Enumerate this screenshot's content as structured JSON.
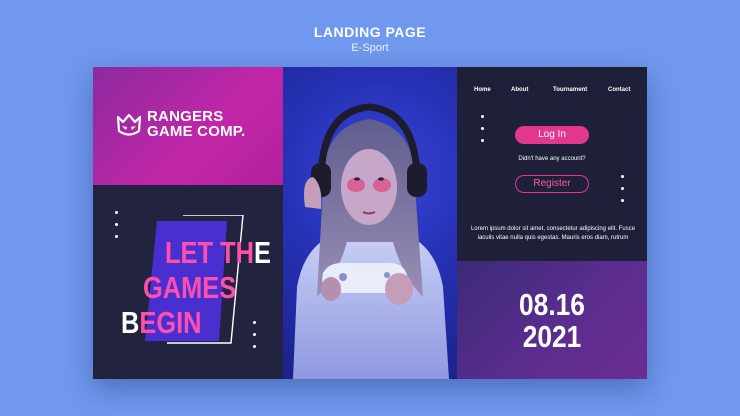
{
  "header": {
    "title": "LANDING PAGE",
    "subtitle": "E-Sport"
  },
  "brand": {
    "line1": "RANGERS",
    "line2": "GAME COMP."
  },
  "hero": {
    "slogan_line1_white": "LET TH",
    "slogan_line1_pink_end": "E",
    "slogan_line2": "GAMES",
    "slogan_line3_white": "B",
    "slogan_line3_rest": "EGIN"
  },
  "nav": {
    "items": [
      "Home",
      "About",
      "Tournament",
      "Contact"
    ]
  },
  "auth": {
    "login_label": "Log In",
    "question": "Didn't have any account?",
    "register_label": "Register"
  },
  "body_text": "Lorem ipsum dolor sit amet, consectetur adipiscing elit. Fusce iaculis vitae nulla quis egestas. Mauris eros diam, rutrum",
  "event_date": {
    "line1": "08.16",
    "line2": "2021"
  },
  "colors": {
    "accent": "#e2378f",
    "background": "#6f98ee",
    "panel": "#1d2038",
    "brand": "#c226a8"
  }
}
